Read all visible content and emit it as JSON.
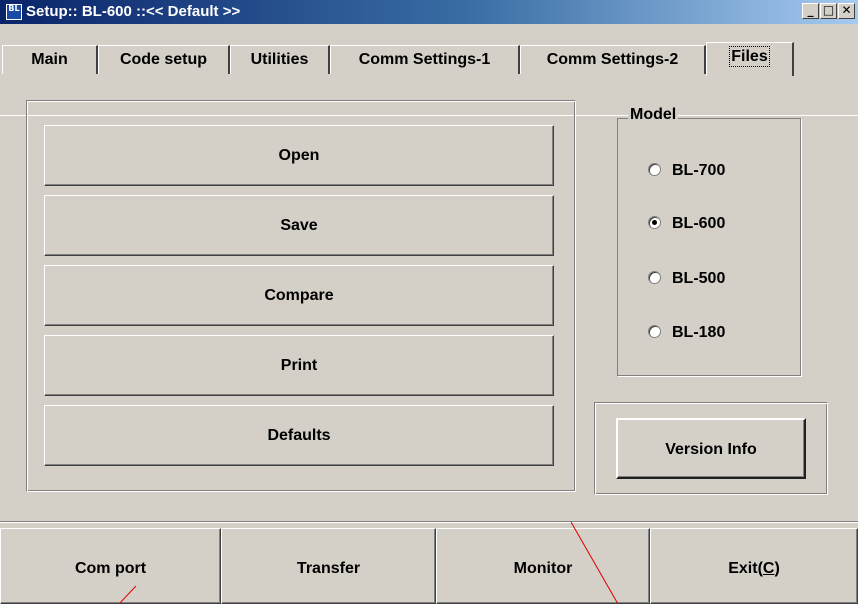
{
  "window": {
    "title": "Setup:: BL-600 ::<< Default >>",
    "icon_text": "BL",
    "min_glyph": "_",
    "max_glyph": "□",
    "close_glyph": "✕"
  },
  "tabs": [
    {
      "label": "Main",
      "active": false
    },
    {
      "label": "Code setup",
      "active": false
    },
    {
      "label": "Utilities",
      "active": false
    },
    {
      "label": "Comm Settings-1",
      "active": false
    },
    {
      "label": "Comm Settings-2",
      "active": false
    },
    {
      "label": "Files",
      "active": true
    }
  ],
  "files": {
    "buttons": [
      "Open",
      "Save",
      "Compare",
      "Print",
      "Defaults"
    ]
  },
  "model": {
    "legend": "Model",
    "options": [
      {
        "label": "BL-700",
        "selected": false
      },
      {
        "label": "BL-600",
        "selected": true
      },
      {
        "label": "BL-500",
        "selected": false
      },
      {
        "label": "BL-180",
        "selected": false
      }
    ]
  },
  "version_button": "Version Info",
  "bottom_bar": {
    "com_port": "Com port",
    "transfer": "Transfer",
    "monitor": "Monitor",
    "exit_prefix": "Exit(",
    "exit_key": "C",
    "exit_suffix": ")"
  },
  "colors": {
    "face": "#d4d0c8",
    "title_start": "#0a246a",
    "title_end": "#a6caf0",
    "annotation": "#e00000"
  }
}
